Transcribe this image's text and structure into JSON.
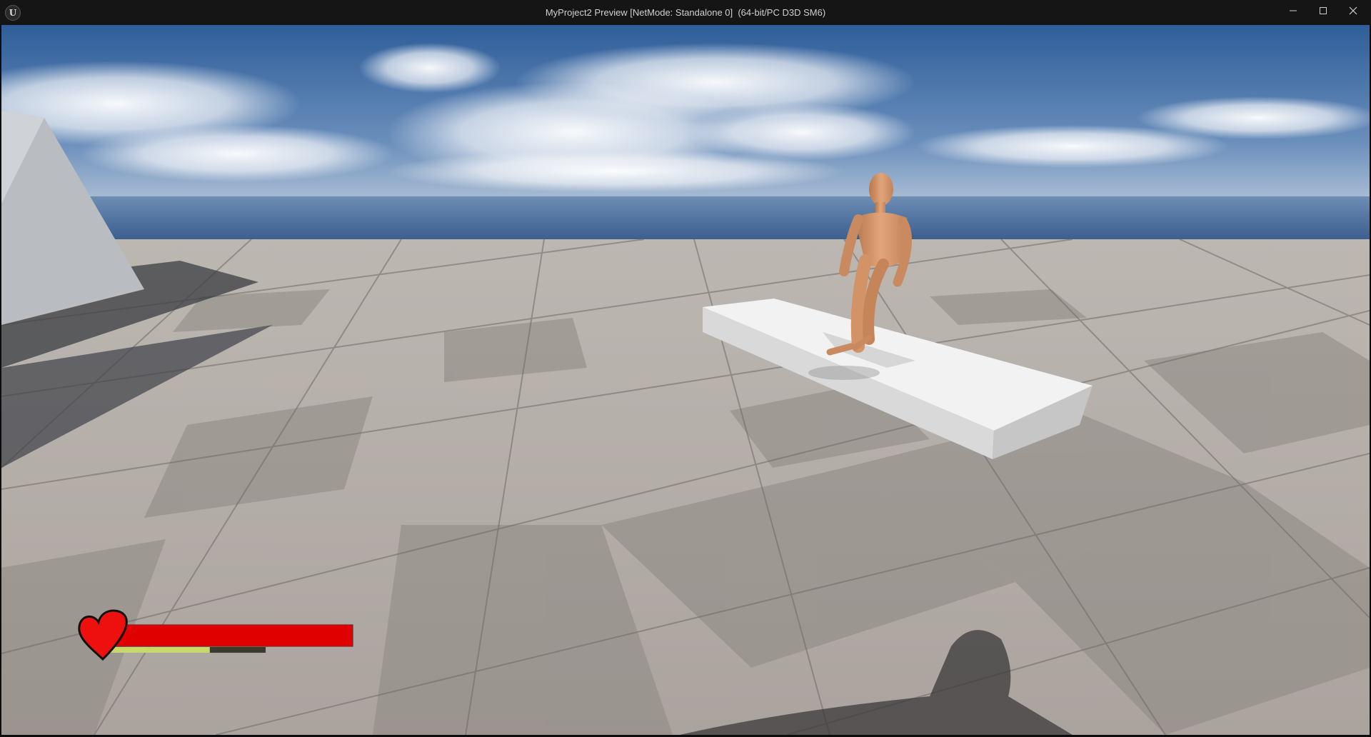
{
  "window": {
    "title": "MyProject2 Preview [NetMode: Standalone 0]  (64-bit/PC D3D SM6)",
    "app_icon_glyph": "U",
    "controls": [
      {
        "name": "minimize-button",
        "icon": "minimize-icon"
      },
      {
        "name": "maximize-button",
        "icon": "maximize-icon"
      },
      {
        "name": "close-button",
        "icon": "close-icon"
      }
    ]
  },
  "hud": {
    "health_icon": "heart-icon",
    "health_fraction": 1.0,
    "stamina_fraction": 0.66,
    "colors": {
      "health": "#e00000",
      "stamina": "#c8d86a",
      "heart": "#ee0f0f"
    }
  },
  "scene": {
    "colors": {
      "sky_top": "#3f6aa2",
      "sky_horizon": "#a9bdd3",
      "floor_light": "#c6c0bb",
      "floor_dark": "#8f8a86",
      "mannequin": "#d89a6e",
      "block": "#ececec"
    }
  }
}
